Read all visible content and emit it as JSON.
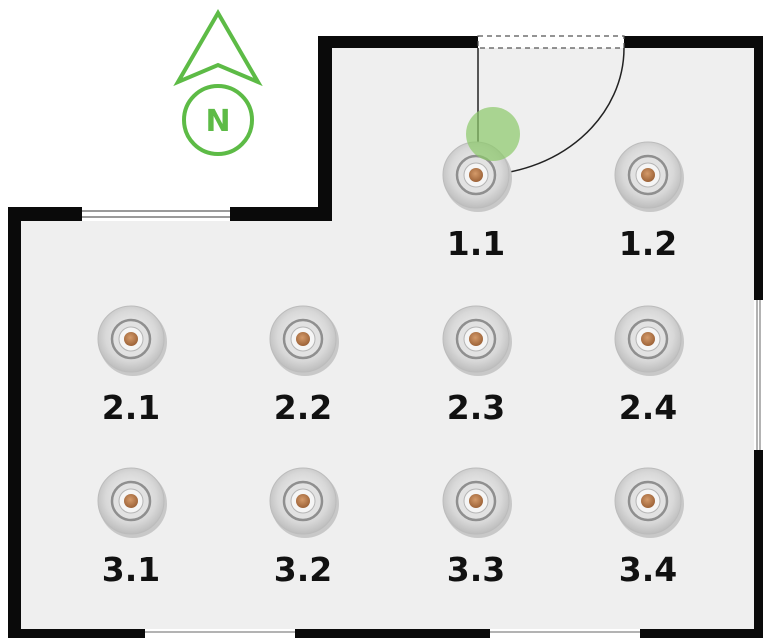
{
  "compass": {
    "letter": "N",
    "color": "#5dbb46",
    "icon": "north-arrow-icon"
  },
  "colors": {
    "wall": "#0a0a0a",
    "floor": "#efefef",
    "window": "#9a9a9a",
    "lamp_trim": "#d2d2d2",
    "lamp_core": "#b97d4f",
    "marker": "#8cc96a"
  },
  "lamps": [
    {
      "id": "1.1",
      "label": "1.1"
    },
    {
      "id": "1.2",
      "label": "1.2"
    },
    {
      "id": "2.1",
      "label": "2.1"
    },
    {
      "id": "2.2",
      "label": "2.2"
    },
    {
      "id": "2.3",
      "label": "2.3"
    },
    {
      "id": "2.4",
      "label": "2.4"
    },
    {
      "id": "3.1",
      "label": "3.1"
    },
    {
      "id": "3.2",
      "label": "3.2"
    },
    {
      "id": "3.3",
      "label": "3.3"
    },
    {
      "id": "3.4",
      "label": "3.4"
    }
  ],
  "door": {
    "icon": "door-swing-icon"
  },
  "selected_marker": {
    "icon": "position-marker-icon",
    "near": "1.1"
  }
}
